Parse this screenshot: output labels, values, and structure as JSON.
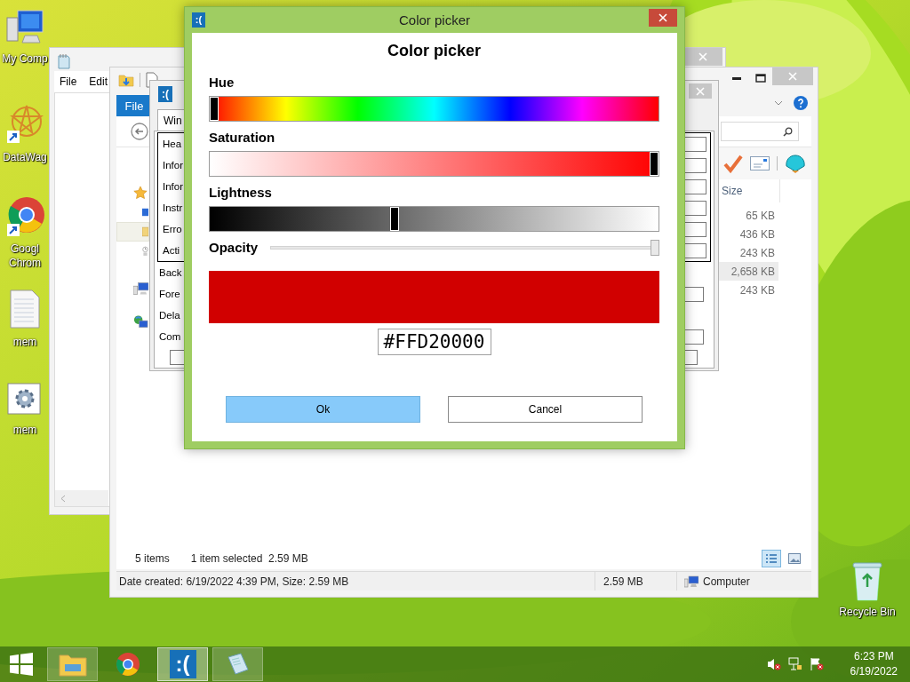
{
  "desktop": {
    "icons": [
      {
        "kind": "computer",
        "label": "My Comp"
      },
      {
        "kind": "shortcut-star",
        "label": "DataWag"
      },
      {
        "kind": "chrome",
        "label": "Googl Chrom"
      },
      {
        "kind": "text-file",
        "label": "mem"
      },
      {
        "kind": "settings-file",
        "label": "mem"
      }
    ],
    "recycle_bin": {
      "label": "Recycle Bin"
    }
  },
  "notepad": {
    "menu": [
      "File",
      "Edit"
    ]
  },
  "explorer": {
    "ribbon_tabs": [
      {
        "label": "File",
        "selected": true
      }
    ],
    "nav_items": [
      {
        "kind": "favorites",
        "selected": false,
        "children": [
          {
            "kind": "desktop",
            "selected": false
          },
          {
            "kind": "folder",
            "selected": true
          },
          {
            "kind": "recent",
            "selected": false
          }
        ]
      },
      {
        "kind": "computer",
        "selected": false
      },
      {
        "kind": "network",
        "selected": false
      }
    ],
    "column_header": "Size",
    "sizes": [
      {
        "text": "65 KB",
        "selected": false
      },
      {
        "text": "436 KB",
        "selected": false
      },
      {
        "text": "243 KB",
        "selected": false
      },
      {
        "text": "2,658 KB",
        "selected": true
      },
      {
        "text": "243 KB",
        "selected": false
      }
    ],
    "status": {
      "items": "5 items",
      "selection": "1 item selected  2.59 MB"
    },
    "details_bar": {
      "info": "Date created: 6/19/2022 4:39 PM, Size: 2.59 MB",
      "size": "2.59 MB",
      "location": "Computer"
    }
  },
  "memz_window": {
    "icon_text": ":(",
    "tab": "Win",
    "list_items": [
      "Hea",
      "Infor",
      "Infor",
      "Instr",
      "Erro",
      "Acti"
    ],
    "settings": [
      {
        "label": "Back",
        "kind": "label"
      },
      {
        "label": "Fore",
        "kind": "field"
      },
      {
        "label": "Dela",
        "kind": "label"
      },
      {
        "label": "Com",
        "kind": "field"
      }
    ]
  },
  "dialog": {
    "icon_text": ":(",
    "title": "Color picker",
    "heading": "Color picker",
    "sliders": [
      {
        "kind": "hue",
        "label": "Hue",
        "level": 0
      },
      {
        "kind": "saturation",
        "label": "Saturation",
        "level": 1
      },
      {
        "kind": "lightness",
        "label": "Lightness",
        "level": 0.41
      },
      {
        "kind": "opacity",
        "label": "Opacity",
        "level": 1
      }
    ],
    "hex_value": "#FFD20000",
    "buttons": [
      {
        "label": "Ok",
        "focused": true
      },
      {
        "label": "Cancel",
        "focused": false
      }
    ]
  },
  "taskbar": {
    "apps": [
      {
        "kind": "explorer",
        "running": true,
        "active": false
      },
      {
        "kind": "chrome",
        "running": false,
        "active": false
      },
      {
        "kind": "memz",
        "label": ":(",
        "running": true,
        "active": true
      },
      {
        "kind": "notepad",
        "running": true,
        "active": false
      }
    ],
    "clock": {
      "time": "6:23 PM",
      "date": "6/19/2022"
    }
  }
}
